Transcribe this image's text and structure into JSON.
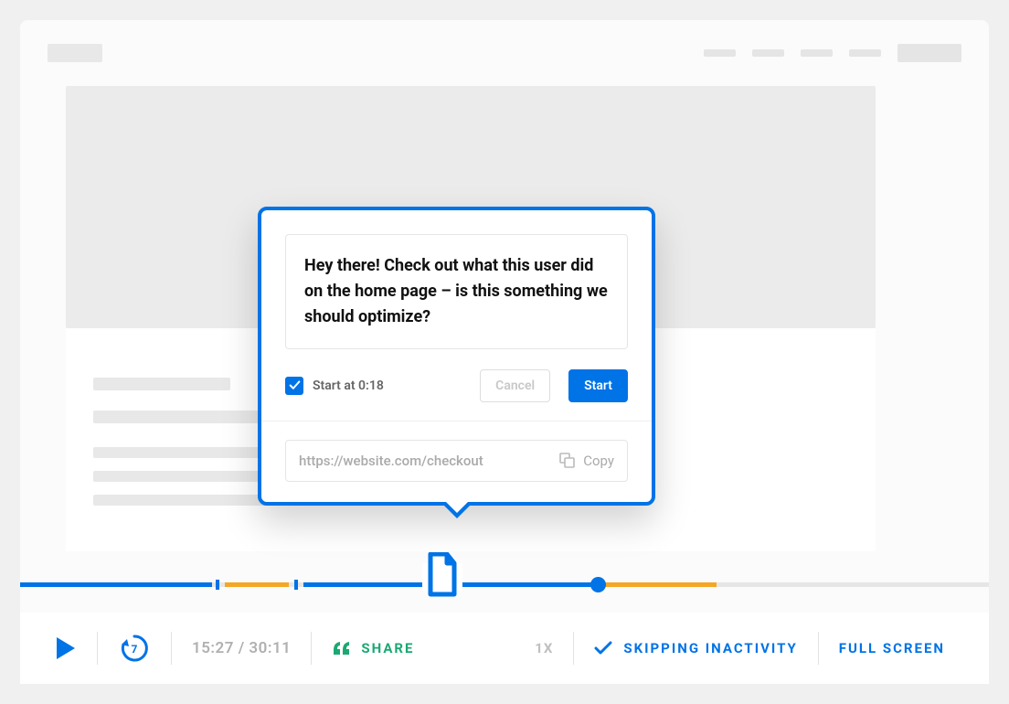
{
  "popover": {
    "message": "Hey there! Check out what this user did on the home page – is this something we should optimize?",
    "start_at_label": "Start at 0:18",
    "cancel_label": "Cancel",
    "start_label": "Start",
    "url_value": "https://website.com/checkout",
    "copy_label": "Copy"
  },
  "controls": {
    "rewind_seconds": "7",
    "time_current": "15:27",
    "time_total": "30:11",
    "time_display": "15:27 / 30:11",
    "share_label": "SHARE",
    "speed_label": "1X",
    "skipping_label": "SKIPPING INACTIVITY",
    "fullscreen_label": "FULL SCREEN"
  },
  "colors": {
    "primary": "#0073e6",
    "accent_green": "#1aa972",
    "accent_orange": "#f5a623"
  }
}
